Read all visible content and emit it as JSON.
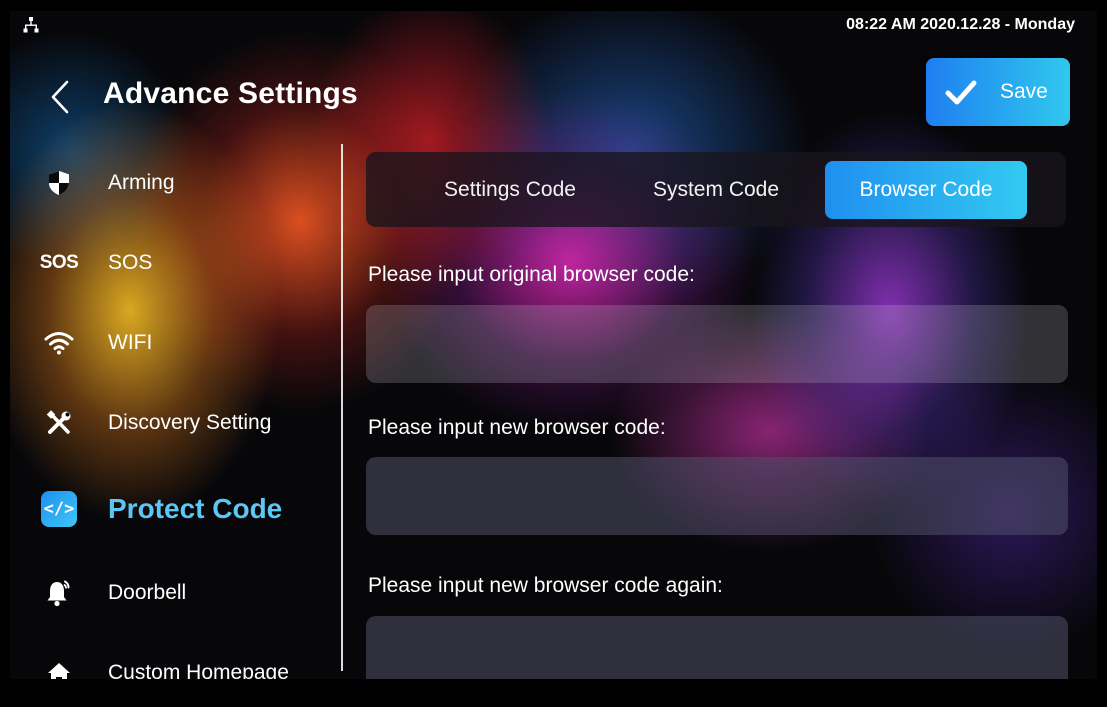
{
  "status": {
    "datetime": "08:22 AM  2020.12.28 - Monday"
  },
  "header": {
    "title": "Advance Settings",
    "save_label": "Save"
  },
  "sidebar": {
    "items": [
      {
        "label": "Arming",
        "icon": "shield-icon"
      },
      {
        "label": "SOS",
        "icon": "sos-icon",
        "icon_text": "SOS"
      },
      {
        "label": "WIFI",
        "icon": "wifi-icon"
      },
      {
        "label": "Discovery Setting",
        "icon": "tools-icon"
      },
      {
        "label": "Protect Code",
        "icon": "code-icon",
        "icon_text": "</>",
        "active": true
      },
      {
        "label": "Doorbell",
        "icon": "bell-icon"
      },
      {
        "label": "Custom Homepage",
        "icon": "home-icon"
      }
    ]
  },
  "tabs": [
    {
      "label": "Settings Code"
    },
    {
      "label": "System Code"
    },
    {
      "label": "Browser Code",
      "active": true
    }
  ],
  "form": {
    "original_label": "Please input original browser code:",
    "original_value": "",
    "new_label": "Please input new browser code:",
    "new_value": "",
    "again_label": "Please input new browser code again:",
    "again_value": ""
  },
  "colors": {
    "accent": "#2aaef0",
    "active_text": "#5cc6f4",
    "background": "#07070a"
  }
}
